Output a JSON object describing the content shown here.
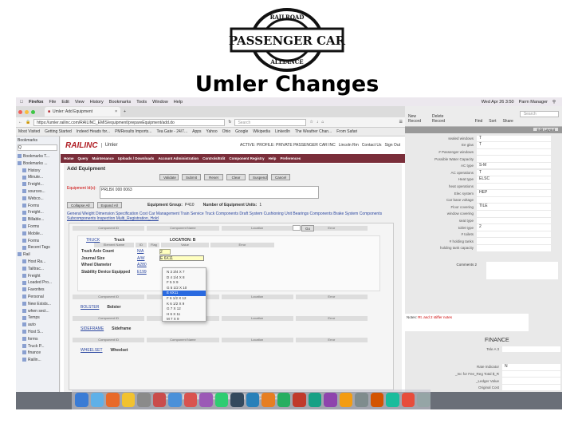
{
  "logo": {
    "top_text": "RAILROAD",
    "main_text": "PASSENGER CAR",
    "bottom_text": "ALLIANCE"
  },
  "slide_title": "Umler Changes",
  "mac_menubar": {
    "items": [
      "Firefox",
      "File",
      "Edit",
      "View",
      "History",
      "Bookmarks",
      "Tools",
      "Window",
      "Help"
    ],
    "clock": "Wed Apr 26 3:50",
    "user": "Parm Manager"
  },
  "browser": {
    "tab_title": "Umler: Add Equipment",
    "url": "https://umler.railinc.com/RAILINC_EMIS/equipment/prepareEquipment/add.do",
    "search_placeholder": "Search",
    "bookmarks": [
      "Most Visited",
      "Getting Started",
      "Indeed Heads for...",
      "PMResults Imports...",
      "Tea Gate - 24/7...",
      "Apps",
      "Yahoo",
      "Ohio",
      "Google",
      "Wikipedia",
      "LinkedIn",
      "The Weather Chan...",
      "From Safari"
    ]
  },
  "sidebar": {
    "title": "Bookmarks",
    "search_placeholder": "Q",
    "items": [
      "Bookmarks T...",
      "Bookmarks ...",
      "History",
      "Minute...",
      "Freight...",
      "sources...",
      "Webco...",
      "Forms",
      "Freight...",
      "Billable...",
      "Forms",
      "Mobile...",
      "Forms",
      "Recent Tags",
      "Rail",
      "Host Ra...",
      "Tailtrac...",
      "Freight",
      "Loaded Pro...",
      "Favorites",
      "Personal",
      "New Exists...",
      "when sect...",
      "Temps",
      "auto",
      "Host S...",
      "forms",
      "Truck P...",
      "finance",
      "Railin..."
    ]
  },
  "railinc": {
    "brand": "RAILINC",
    "app": "Umler",
    "header_right": [
      "ACTIVE: PROFILE: PRIVATE PASSENGER CAR INC",
      "Lincoln Rm",
      "Contact Us",
      "Sign Out"
    ],
    "nav": [
      "Home",
      "Query",
      "Maintenance",
      "Uploads / Downloads",
      "Account Administration",
      "Controls/Edit",
      "Component Registry",
      "Help",
      "Preferences"
    ],
    "page_title": "Add Equipment",
    "action_buttons": [
      "Validate",
      "Submit",
      "Reset",
      "Clear",
      "Suspend",
      "Cancel"
    ],
    "equipment_id_label": "Equipment Id(s):",
    "equipment_id_value": "PRLBX 000 0063",
    "collapse_all": "Collapse All",
    "expand_all": "Expand All",
    "equipment_group_label": "Equipment Group:",
    "equipment_group_value": "P410",
    "num_units_label": "Number of Equipment Units:",
    "num_units_value": "1",
    "section_links": "General  Weight  Dimension  Specification  Cost  Car Management  Train Service  Truck Components  Draft System  Cushioning Unit  Bearings  Components  Brake System  Components",
    "section_links2": "Subcomponents  Inspection  Multi_Registration_Hold",
    "comp_headers": [
      "Component ID",
      "Component Name",
      "Location",
      "Error"
    ],
    "go": "Go",
    "truck": {
      "link": "TRUCK",
      "name": "Truck",
      "location": "LOCATION: B",
      "col_headers": [
        "Element Name",
        "ID",
        "Flag",
        "Value",
        "Error"
      ],
      "rows": [
        {
          "name": "Truck Axle Count",
          "id": "N/A",
          "value": "2"
        },
        {
          "name": "Journal Size",
          "id": "A/W",
          "value": "E 6X11"
        },
        {
          "name": "Wheel Diameter",
          "id": "A280",
          "value": ""
        },
        {
          "name": "Stability Device Equipped",
          "id": "E199",
          "value": ""
        }
      ]
    },
    "journal_options": [
      "N 3 3/4 X 7",
      "D 4 1/4 X 8",
      "F 5 X 9",
      "G 5 1/2 X 10",
      "E 6X11",
      "F 6 1/2 X 12",
      "K 6 1/2 X 9",
      "G 7 X 12",
      "H 6 X 11",
      "M 7 X 9"
    ],
    "journal_selected_index": 4,
    "sections": [
      {
        "link": "BOLSTER",
        "name": "Bolster"
      },
      {
        "link": "SIDEFRAME",
        "name": "Sideframe"
      },
      {
        "link": "WHEELSET",
        "name": "Wheelset"
      }
    ]
  },
  "filemaker": {
    "toolbar": [
      "New Record",
      "Delete Record",
      "Find",
      "Sort",
      "Share"
    ],
    "search_placeholder": "Search",
    "layout_btn": "Edit Layout",
    "fields": [
      {
        "label": "sealed windows",
        "value": "T"
      },
      {
        "label": "Ee glas",
        "value": "T"
      },
      {
        "label": "# Passenger windows",
        "value": ""
      },
      {
        "label": "Possible Water Capacity",
        "value": ""
      },
      {
        "label": "AC type",
        "value": "S-M"
      },
      {
        "label": "AC operations",
        "value": "T"
      },
      {
        "label": "Heat type",
        "value": "ELSC"
      },
      {
        "label": "heat operations",
        "value": ""
      },
      {
        "label": "Elec system",
        "value": "HEP"
      },
      {
        "label": "Car base voltage",
        "value": ""
      },
      {
        "label": "Floor covering",
        "value": "TILE"
      },
      {
        "label": "window covering",
        "value": ""
      },
      {
        "label": "seat type",
        "value": ""
      },
      {
        "label": "toilet type",
        "value": "2"
      },
      {
        "label": "# toilets",
        "value": ""
      },
      {
        "label": "# holding tanks",
        "value": ""
      },
      {
        "label": "holding tank capacity",
        "value": ""
      }
    ],
    "comments_label": "Comments 2",
    "note_label": "Notes:",
    "note_text": "Rt. and 2 stiffer notes",
    "finance_header": "FINANCE",
    "finance_fields": [
      {
        "label": "Tele A 3",
        "value": ""
      },
      {
        "label": "Rate Indicator",
        "value": "N"
      },
      {
        "label": "_Inc for Fee_Reg Total $_R",
        "value": ""
      },
      {
        "label": "_Ledger Value",
        "value": ""
      },
      {
        "label": "Original Cost",
        "value": ""
      }
    ]
  },
  "colors": {
    "railinc_red": "#b01e24",
    "nav_bar": "#7a2e3a",
    "selection": "#2a6ae0"
  }
}
